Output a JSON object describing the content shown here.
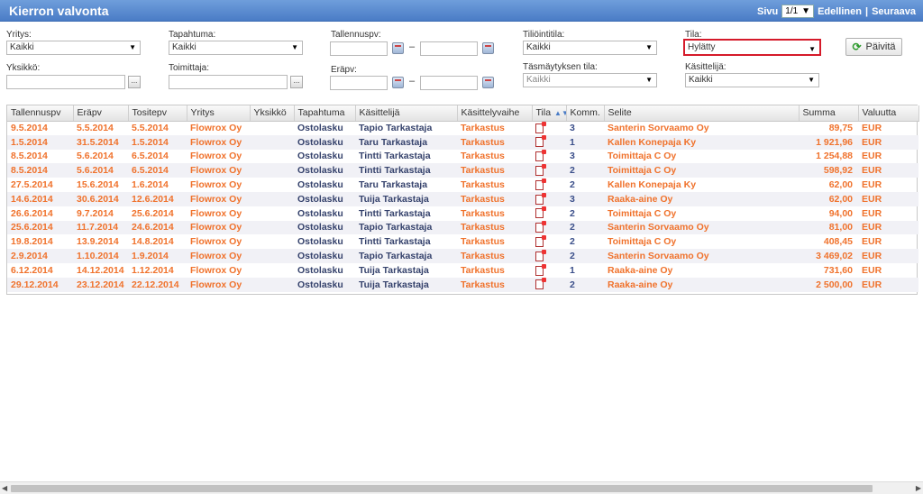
{
  "title": "Kierron valvonta",
  "pager": {
    "label": "Sivu",
    "page": "1/1",
    "prev": "Edellinen",
    "sep": "|",
    "next": "Seuraava"
  },
  "filters": {
    "yritys": {
      "label": "Yritys:",
      "value": "Kaikki"
    },
    "tapahtuma": {
      "label": "Tapahtuma:",
      "value": "Kaikki"
    },
    "tallennuspv": {
      "label": "Tallennuspv:",
      "dash": "–"
    },
    "tiliointitila": {
      "label": "Tiliöintitila:",
      "value": "Kaikki"
    },
    "tila": {
      "label": "Tila:",
      "value": "Hylätty"
    },
    "refresh": "Päivitä",
    "yksikko": {
      "label": "Yksikkö:",
      "btn": "..."
    },
    "toimittaja": {
      "label": "Toimittaja:",
      "btn": "..."
    },
    "erapv": {
      "label": "Eräpv:",
      "dash": "–"
    },
    "tasmaytyksen_tila": {
      "label": "Täsmäytyksen tila:",
      "value": "Kaikki"
    },
    "kasittelija": {
      "label": "Käsittelijä:",
      "value": "Kaikki"
    }
  },
  "table": {
    "headers": [
      "Tallennuspv",
      "Eräpv",
      "Tositepv",
      "Yritys",
      "Yksikkö",
      "Tapahtuma",
      "Käsittelijä",
      "Käsittelyvaihe",
      "Tila",
      "Komm.",
      "Selite",
      "Summa",
      "Valuutta"
    ],
    "rows": [
      [
        "9.5.2014",
        "5.5.2014",
        "5.5.2014",
        "Flowrox Oy",
        "",
        "Ostolasku",
        "Tapio Tarkastaja",
        "Tarkastus",
        "",
        "3",
        "Santerin Sorvaamo Oy",
        "89,75",
        "EUR"
      ],
      [
        "1.5.2014",
        "31.5.2014",
        "1.5.2014",
        "Flowrox Oy",
        "",
        "Ostolasku",
        "Taru Tarkastaja",
        "Tarkastus",
        "",
        "1",
        "Kallen Konepaja Ky",
        "1 921,96",
        "EUR"
      ],
      [
        "8.5.2014",
        "5.6.2014",
        "6.5.2014",
        "Flowrox Oy",
        "",
        "Ostolasku",
        "Tintti Tarkastaja",
        "Tarkastus",
        "",
        "3",
        "Toimittaja C Oy",
        "1 254,88",
        "EUR"
      ],
      [
        "8.5.2014",
        "5.6.2014",
        "6.5.2014",
        "Flowrox Oy",
        "",
        "Ostolasku",
        "Tintti Tarkastaja",
        "Tarkastus",
        "",
        "2",
        "Toimittaja C Oy",
        "598,92",
        "EUR"
      ],
      [
        "27.5.2014",
        "15.6.2014",
        "1.6.2014",
        "Flowrox Oy",
        "",
        "Ostolasku",
        "Taru Tarkastaja",
        "Tarkastus",
        "",
        "2",
        "Kallen Konepaja Ky",
        "62,00",
        "EUR"
      ],
      [
        "14.6.2014",
        "30.6.2014",
        "12.6.2014",
        "Flowrox Oy",
        "",
        "Ostolasku",
        "Tuija Tarkastaja",
        "Tarkastus",
        "",
        "3",
        "Raaka-aine Oy",
        "62,00",
        "EUR"
      ],
      [
        "26.6.2014",
        "9.7.2014",
        "25.6.2014",
        "Flowrox Oy",
        "",
        "Ostolasku",
        "Tintti Tarkastaja",
        "Tarkastus",
        "",
        "2",
        "Toimittaja C Oy",
        "94,00",
        "EUR"
      ],
      [
        "25.6.2014",
        "11.7.2014",
        "24.6.2014",
        "Flowrox Oy",
        "",
        "Ostolasku",
        "Tapio Tarkastaja",
        "Tarkastus",
        "",
        "2",
        "Santerin Sorvaamo Oy",
        "81,00",
        "EUR"
      ],
      [
        "19.8.2014",
        "13.9.2014",
        "14.8.2014",
        "Flowrox Oy",
        "",
        "Ostolasku",
        "Tintti Tarkastaja",
        "Tarkastus",
        "",
        "2",
        "Toimittaja C Oy",
        "408,45",
        "EUR"
      ],
      [
        "2.9.2014",
        "1.10.2014",
        "1.9.2014",
        "Flowrox Oy",
        "",
        "Ostolasku",
        "Tapio Tarkastaja",
        "Tarkastus",
        "",
        "2",
        "Santerin Sorvaamo Oy",
        "3 469,02",
        "EUR"
      ],
      [
        "6.12.2014",
        "14.12.2014",
        "1.12.2014",
        "Flowrox Oy",
        "",
        "Ostolasku",
        "Tuija Tarkastaja",
        "Tarkastus",
        "",
        "1",
        "Raaka-aine Oy",
        "731,60",
        "EUR"
      ],
      [
        "29.12.2014",
        "23.12.2014",
        "22.12.2014",
        "Flowrox Oy",
        "",
        "Ostolasku",
        "Tuija Tarkastaja",
        "Tarkastus",
        "",
        "2",
        "Raaka-aine Oy",
        "2 500,00",
        "EUR"
      ]
    ]
  }
}
